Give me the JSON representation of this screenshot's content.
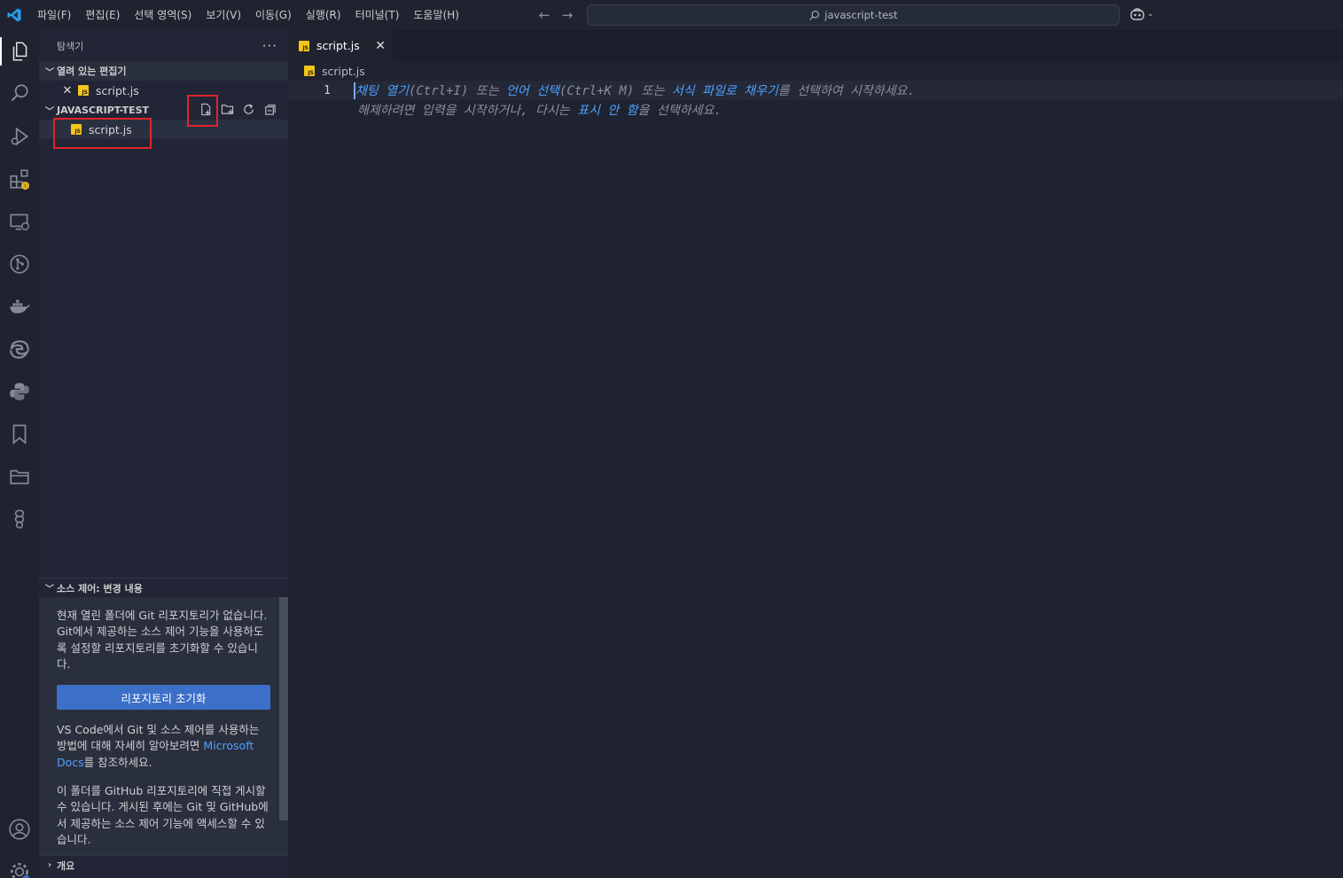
{
  "menu": [
    "파일(F)",
    "편집(E)",
    "선택 영역(S)",
    "보기(V)",
    "이동(G)",
    "실행(R)",
    "터미널(T)",
    "도움말(H)"
  ],
  "search": {
    "label": "javascript-test"
  },
  "sidebar": {
    "title": "탐색기",
    "more": "···",
    "open_editors": {
      "label": "열려 있는 편집기",
      "file": "script.js"
    },
    "project": {
      "label": "JAVASCRIPT-TEST",
      "file": "script.js"
    },
    "scm": {
      "label": "소스 제어: 변경 내용",
      "message1": "현재 열린 폴더에 Git 리포지토리가 없습니다. Git에서 제공하는 소스 제어 기능을 사용하도록 설정할 리포지토리를 초기화할 수 있습니다.",
      "init_button": "리포지토리 초기화",
      "message2_prefix": "VS Code에서 Git 및 소스 제어를 사용하는 방법에 대해 자세히 알아보려면 ",
      "message2_link": "Microsoft Docs",
      "message2_suffix": "를 참조하세요.",
      "message3": "이 폴더를 GitHub 리포지토리에 직접 게시할 수 있습니다. 게시된 후에는 Git 및 GitHub에서 제공하는 소스 제어 기능에 액세스할 수 있습니다."
    },
    "outline": {
      "label": "개요"
    }
  },
  "editor": {
    "tab": "script.js",
    "breadcrumb": "script.js",
    "line_number": "1",
    "hint1": [
      {
        "text": "채팅 열기",
        "link": true
      },
      {
        "text": "(Ctrl+I) 또는 ",
        "link": false
      },
      {
        "text": "언어 선택",
        "link": true
      },
      {
        "text": "(Ctrl+K M) 또는 ",
        "link": false
      },
      {
        "text": "서식 파일로 채우기",
        "link": true
      },
      {
        "text": "를 선택하여 시작하세요.",
        "link": false
      }
    ],
    "hint2": [
      {
        "text": "해제하려면 입력을 시작하거나, 다시는 ",
        "link": false
      },
      {
        "text": "표시 안 함",
        "link": true
      },
      {
        "text": "을 선택하세요.",
        "link": false
      }
    ]
  },
  "colors": {
    "accent": "#3c6fc8",
    "link": "#4ea1ff",
    "highlight": "#e0242a",
    "js_icon": "#f5c518"
  }
}
